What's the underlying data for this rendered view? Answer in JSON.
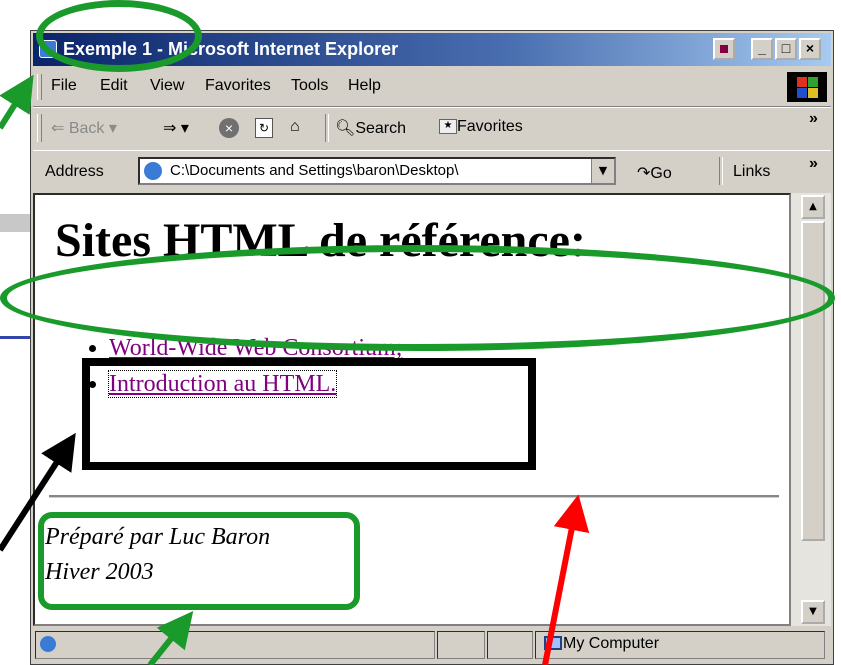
{
  "window": {
    "title": "Exemple 1 - Microsoft Internet Explorer",
    "buttons": [
      "minimize",
      "maximize",
      "close"
    ]
  },
  "menubar": {
    "items": [
      "File",
      "Edit",
      "View",
      "Favorites",
      "Tools",
      "Help"
    ]
  },
  "toolbar": {
    "back": "Back",
    "search": "Search",
    "favorites": "Favorites",
    "more": "»"
  },
  "address": {
    "label": "Address",
    "value": "C:\\Documents and Settings\\baron\\Desktop\\",
    "go": "Go",
    "links": "Links",
    "more": "»"
  },
  "page": {
    "heading": "Sites HTML de référence:",
    "links": [
      "World-Wide Web Consortium;",
      "Introduction au HTML."
    ],
    "footer_line1": "Préparé par Luc Baron",
    "footer_line2": "Hiver 2003"
  },
  "statusbar": {
    "zone": "My Computer"
  },
  "colors": {
    "annotation_green": "#1a9a2a",
    "annotation_red": "#ff0000",
    "annotation_black": "#000000",
    "visited_link": "#800080",
    "titlebar": "#0a246a"
  },
  "icons": [
    "ie-page-icon",
    "back-arrow-icon",
    "forward-arrow-icon",
    "stop-icon",
    "refresh-icon",
    "home-icon",
    "search-icon",
    "favorites-icon",
    "go-icon",
    "windows-logo-icon",
    "computer-icon"
  ]
}
